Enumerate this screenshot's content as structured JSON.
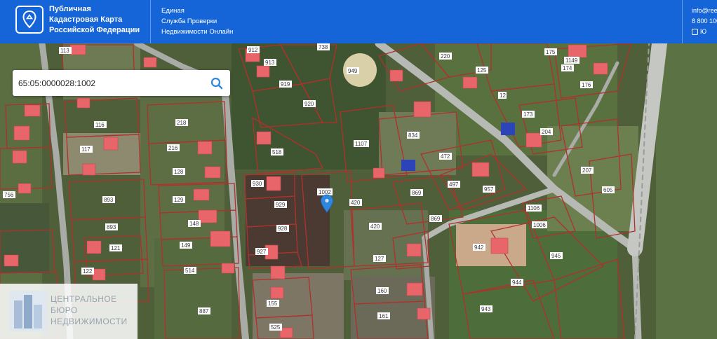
{
  "header": {
    "title_lines": [
      "Публичная",
      "Кадастровая Карта",
      "Российской Федерации"
    ],
    "service_lines": [
      "Единая",
      "Служба Проверки",
      "Недвижимости Онлайн"
    ],
    "contact_email": "info@ree",
    "contact_phone": "8 800 100",
    "checkbox_label": "Ю",
    "logo_icon": "map-pin-icon"
  },
  "search": {
    "value": "65:05:0000028:1002",
    "button_icon": "search-icon"
  },
  "watermark": {
    "lines": [
      "ЦЕНТРАЛЬНОЕ",
      "БЮРО",
      "НЕДВИЖИМОСТИ"
    ]
  },
  "map": {
    "marker_icon": "location-marker-icon",
    "colors": {
      "parcel_border": "#b0312b",
      "label_bg": "#ffffff",
      "label_text": "#3a3a3a",
      "roof": "#e8656a",
      "road": "#b7b9b5",
      "marker": "#2f86dd",
      "header": "#1565d8"
    },
    "parcel_labels": [
      "113",
      "912",
      "913",
      "919",
      "920",
      "738",
      "949",
      "220",
      "125",
      "12",
      "173",
      "204",
      "175",
      "1149",
      "174",
      "176",
      "218",
      "216",
      "117",
      "116",
      "128",
      "756",
      "893",
      "129",
      "148",
      "930",
      "929",
      "928",
      "927",
      "1002",
      "420",
      "518",
      "1107",
      "834",
      "472",
      "497",
      "957",
      "869",
      "1106",
      "942",
      "944",
      "945",
      "943",
      "160",
      "161",
      "155",
      "525",
      "893",
      "121",
      "149",
      "514",
      "887",
      "122",
      "207",
      "605",
      "127",
      "420",
      "869",
      "1006"
    ]
  }
}
